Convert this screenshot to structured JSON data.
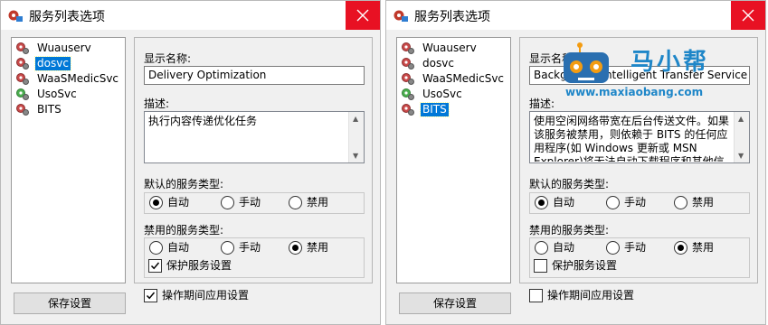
{
  "windows": [
    {
      "title": "服务列表选项",
      "services": [
        "Wuauserv",
        "dosvc",
        "WaaSMedicSvc",
        "UsoSvc",
        "BITS"
      ],
      "selected_index": 1,
      "display_name_label": "显示名称:",
      "display_name_value": "Delivery Optimization",
      "description_label": "描述:",
      "description_text": "执行内容传递优化任务",
      "default_type_label": "默认的服务类型:",
      "default_type_options": [
        "自动",
        "手动",
        "禁用"
      ],
      "default_type_selected": 0,
      "disabled_type_label": "禁用的服务类型:",
      "disabled_type_options": [
        "自动",
        "手动",
        "禁用"
      ],
      "disabled_type_selected": 2,
      "protect_label": "保护服务设置",
      "protect_checked": true,
      "apply_label": "操作期间应用设置",
      "apply_checked": true,
      "save_label": "保存设置"
    },
    {
      "title": "服务列表选项",
      "services": [
        "Wuauserv",
        "dosvc",
        "WaaSMedicSvc",
        "UsoSvc",
        "BITS"
      ],
      "selected_index": 4,
      "display_name_label": "显示名称:",
      "display_name_value": "Background Intelligent Transfer Service",
      "description_label": "描述:",
      "description_text": "使用空闲网络带宽在后台传送文件。如果该服务被禁用，则依赖于 BITS 的任何应用程序(如 Windows 更新或 MSN Explorer)将无法自动下载程序和其他信",
      "default_type_label": "默认的服务类型:",
      "default_type_options": [
        "自动",
        "手动",
        "禁用"
      ],
      "default_type_selected": 0,
      "disabled_type_label": "禁用的服务类型:",
      "disabled_type_options": [
        "自动",
        "手动",
        "禁用"
      ],
      "disabled_type_selected": 2,
      "protect_label": "保护服务设置",
      "protect_checked": false,
      "apply_label": "操作期间应用设置",
      "apply_checked": false,
      "save_label": "保存设置"
    }
  ],
  "watermark": {
    "title": "马小帮",
    "url": "www.maxiaobang.com"
  },
  "icons": {
    "app": "service-app-icon",
    "close": "close-icon",
    "service": "gear-icon",
    "check": "checkmark-icon"
  },
  "colors": {
    "close_button": "#e81123",
    "selection": "#0078d7",
    "watermark": "#1e86c8"
  }
}
